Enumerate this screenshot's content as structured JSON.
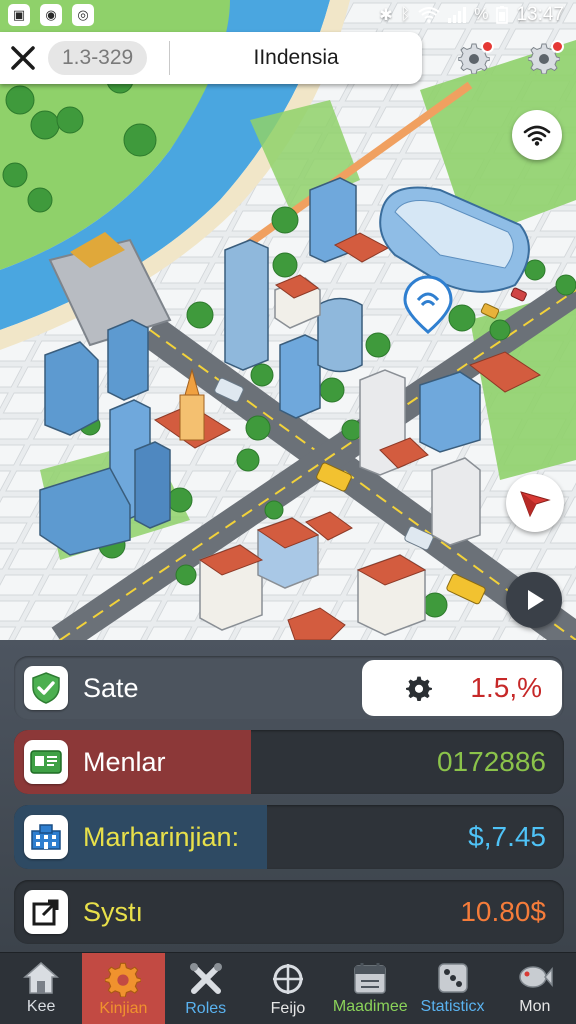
{
  "status_bar": {
    "left_icons": [
      "image-icon",
      "location-icon",
      "circle-app-icon"
    ],
    "signal_text": "%",
    "time": "13:47"
  },
  "top_bar": {
    "code": "1.3-329",
    "region": "IIndensia"
  },
  "stats": [
    {
      "label": "Sate",
      "value": "1.5,%",
      "icon": "shield-check-icon",
      "label_color": "#ffffff",
      "value_color": "#c62828"
    },
    {
      "label": "Menlar",
      "value": "0172886",
      "icon": "id-card-icon",
      "label_color": "#ffffff",
      "value_color": "#8bc34a",
      "fill_color": "#8c3838",
      "level": 0.43
    },
    {
      "label": "Marharinjian:",
      "value": "$,7.45",
      "icon": "building-icon",
      "label_color": "#e8e04a",
      "value_color": "#4fc3f7",
      "fill_color": "#2e4a63",
      "level": 0.46
    },
    {
      "label": "Systı",
      "value": "10.80$",
      "icon": "expand-box-icon",
      "label_color": "#e8e04a",
      "value_color": "#f57c3a"
    }
  ],
  "nav": [
    {
      "label": "Kee",
      "icon": "home-icon",
      "color": "#d9dde2"
    },
    {
      "label": "Kinjian",
      "icon": "gear-icon",
      "color": "#f0922e",
      "active": true
    },
    {
      "label": "Roles",
      "icon": "tools-icon",
      "color": "#5ab3f0"
    },
    {
      "label": "Feijo",
      "icon": "crosshair-icon",
      "color": "#e6e6e6"
    },
    {
      "label": "Maadimee",
      "icon": "calendar-icon",
      "color": "#8bd35a"
    },
    {
      "label": "Statisticx",
      "icon": "dice-icon",
      "color": "#5ab3f0"
    },
    {
      "label": "Mon",
      "icon": "fish-icon",
      "color": "#e6e6e6"
    }
  ],
  "colors": {
    "accent_red": "#c24a43",
    "panel_bg": "#3c434b",
    "map_grass": "#8fd16a",
    "map_water": "#4aa6e0"
  }
}
